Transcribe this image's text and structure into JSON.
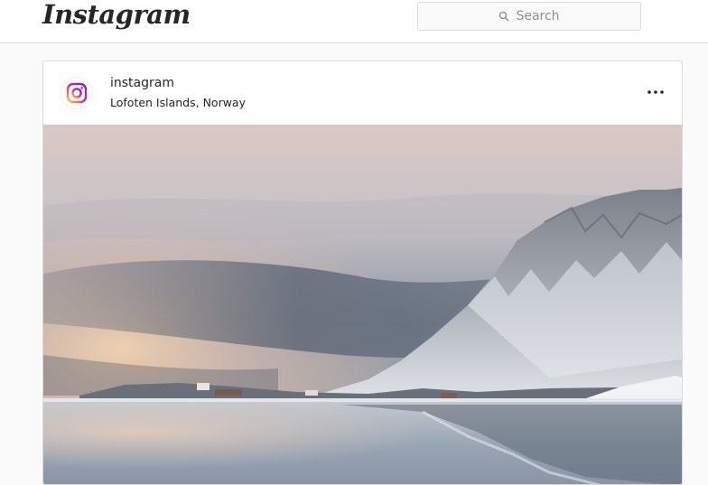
{
  "header": {
    "logo_text": "Instagram",
    "search": {
      "placeholder": "Search",
      "icon": "search-icon"
    }
  },
  "post": {
    "username": "instagram",
    "location": "Lofoten Islands, Norway",
    "avatar_icon": "instagram-logo-icon",
    "more_icon": "more-options-icon",
    "image_subject": "snowy mountain reflected in calm water under a cloudy sunset sky"
  },
  "colors": {
    "background": "#fafafa",
    "border": "#dbdbdb",
    "text": "#262626",
    "muted": "#8e8e8e"
  }
}
